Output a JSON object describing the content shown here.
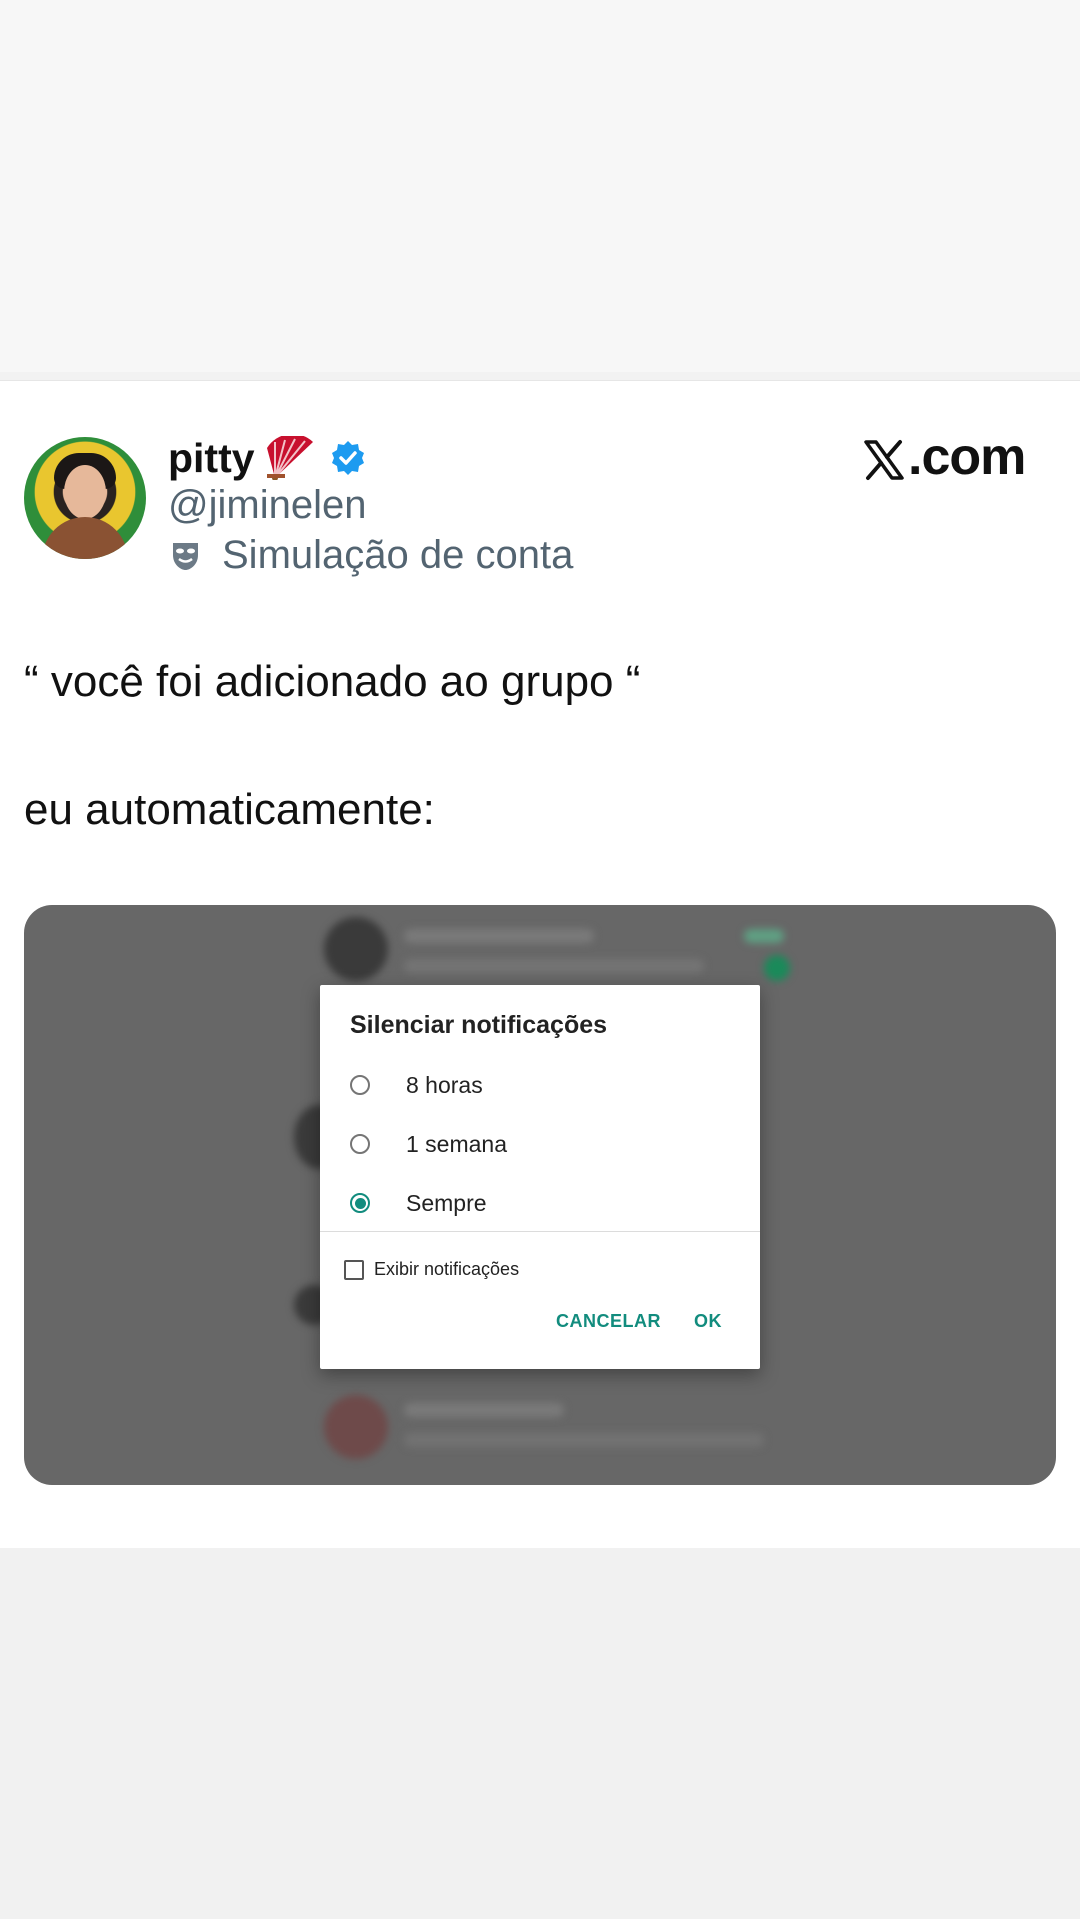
{
  "tweet": {
    "display_name": "pitty",
    "handle": "@jiminelen",
    "account_label": "Simulação de conta",
    "brand": "X.com",
    "brand_suffix": ".com",
    "text_lines": [
      "“ você foi adicionado ao grupo “",
      "eu automaticamente:"
    ]
  },
  "dialog": {
    "title": "Silenciar notificações",
    "options": [
      {
        "label": "8 horas",
        "selected": false
      },
      {
        "label": "1 semana",
        "selected": false
      },
      {
        "label": "Sempre",
        "selected": true
      }
    ],
    "checkbox_label": "Exibir notificações",
    "checkbox_checked": false,
    "cancel_label": "CANCELAR",
    "ok_label": "OK"
  },
  "colors": {
    "accent": "#128c7e",
    "verified": "#1d9bf0",
    "muted_text": "#536471"
  },
  "icons": {
    "verified": "verified-badge-icon",
    "fan": "folding-fan-icon",
    "mask": "performing-arts-mask-icon",
    "x_logo": "x-logo-icon"
  }
}
